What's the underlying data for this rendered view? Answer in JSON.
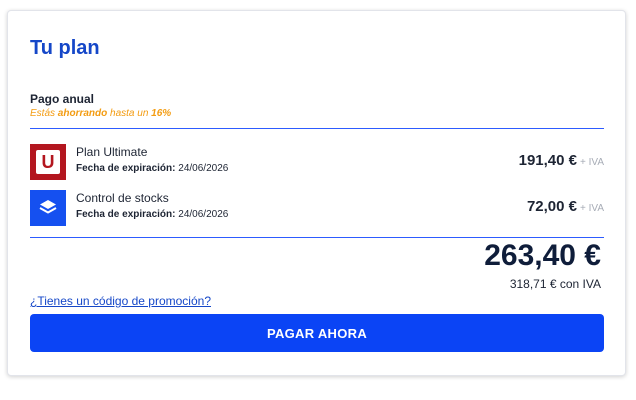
{
  "plan": {
    "title": "Tu plan",
    "billing_label": "Pago anual",
    "savings": {
      "prefix": "Estás ",
      "highlight": "ahorrando",
      "middle": " hasta un ",
      "percent": "16%"
    }
  },
  "items": [
    {
      "icon": "ultimate-u-icon",
      "icon_letter": "U",
      "icon_color": "#b3161f",
      "name": "Plan Ultimate",
      "expiry_label": "Fecha de expiración:",
      "expiry_date": "24/06/2026",
      "price": "191,40 €",
      "vat_note": "+ IVA"
    },
    {
      "icon": "stacked-layers-icon",
      "icon_color": "#1550f0",
      "name": "Control de stocks",
      "expiry_label": "Fecha de expiración:",
      "expiry_date": "24/06/2026",
      "price": "72,00 €",
      "vat_note": "+ IVA"
    }
  ],
  "summary": {
    "total": "263,40 €",
    "total_with_vat": "318,71 € con IVA"
  },
  "promo": {
    "link_text": "¿Tienes un código de promoción?"
  },
  "actions": {
    "pay_label": "PAGAR AHORA"
  },
  "colors": {
    "accent": "#0b44f5",
    "title": "#1547c8",
    "savings": "#f39c12",
    "divider": "#2d5bff"
  }
}
